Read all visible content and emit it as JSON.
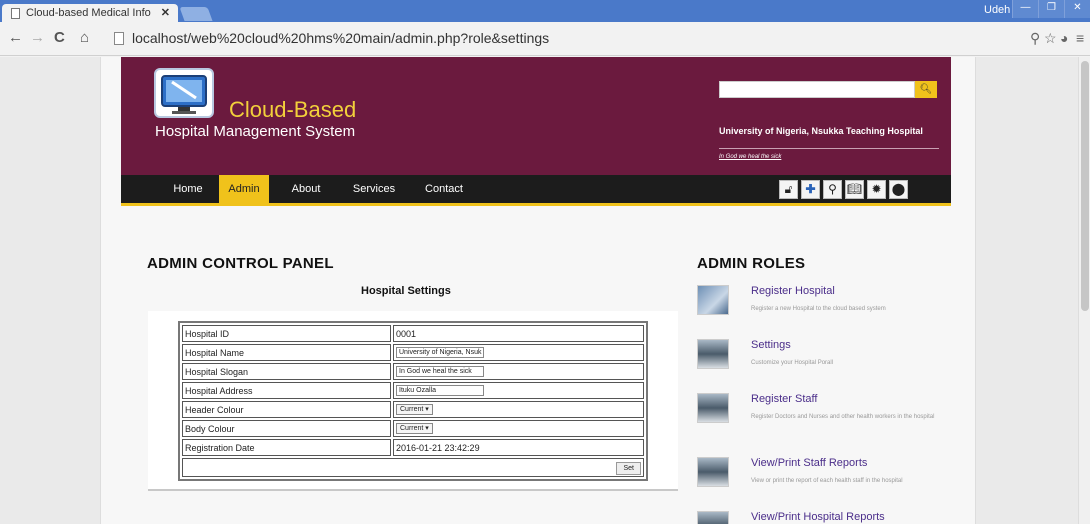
{
  "browser": {
    "tab_title": "Cloud-based Medical Info",
    "url": "localhost/web%20cloud%20hms%20main/admin.php?role&settings",
    "user": "Udeh"
  },
  "site": {
    "title": "Cloud-Based",
    "subtitle": "Hospital Management System",
    "search_placeholder": "",
    "search_icon": "search-icon",
    "hospital_name": "University of Nigeria, Nsukka Teaching Hospital",
    "motto": "In God we heal the sick",
    "accent_color": "#f0c21b",
    "header_color": "#6b1a3e"
  },
  "nav": {
    "items": [
      {
        "label": "Home"
      },
      {
        "label": "Admin"
      },
      {
        "label": "About"
      },
      {
        "label": "Services"
      },
      {
        "label": "Contact"
      }
    ],
    "active": "Admin",
    "icons": [
      "lock-icon",
      "plus-icon",
      "search-icon",
      "book-icon",
      "gear-icon",
      "globe-icon"
    ]
  },
  "main": {
    "heading": "ADMIN CONTROL PANEL",
    "section_title": "Hospital Settings",
    "rows": [
      {
        "label": "Hospital ID",
        "value": "0001",
        "kind": "text"
      },
      {
        "label": "Hospital Name",
        "value": "University of Nigeria, Nsuk",
        "kind": "input"
      },
      {
        "label": "Hospital Slogan",
        "value": "In God we heal the sick",
        "kind": "input"
      },
      {
        "label": "Hospital Address",
        "value": "Ituku Ozalla",
        "kind": "input"
      },
      {
        "label": "Header Colour",
        "value": "Current",
        "kind": "select"
      },
      {
        "label": "Body Colour",
        "value": "Current",
        "kind": "select"
      },
      {
        "label": "Registration Date",
        "value": "2016-01-21 23:42:29",
        "kind": "text"
      }
    ],
    "set_button": "Set"
  },
  "roles": {
    "heading": "ADMIN ROLES",
    "items": [
      {
        "title": "Register Hospital",
        "desc": "Register a new Hospital to the cloud based system"
      },
      {
        "title": "Settings",
        "desc": "Customize your Hospital Porall"
      },
      {
        "title": "Register Staff",
        "desc": "Register Doctors and Nurses and other health workers in the hospital"
      },
      {
        "title": "View/Print Staff Reports",
        "desc": "View or print the report of each health staff in the hospital"
      },
      {
        "title": "View/Print Hospital Reports",
        "desc": ""
      }
    ]
  }
}
